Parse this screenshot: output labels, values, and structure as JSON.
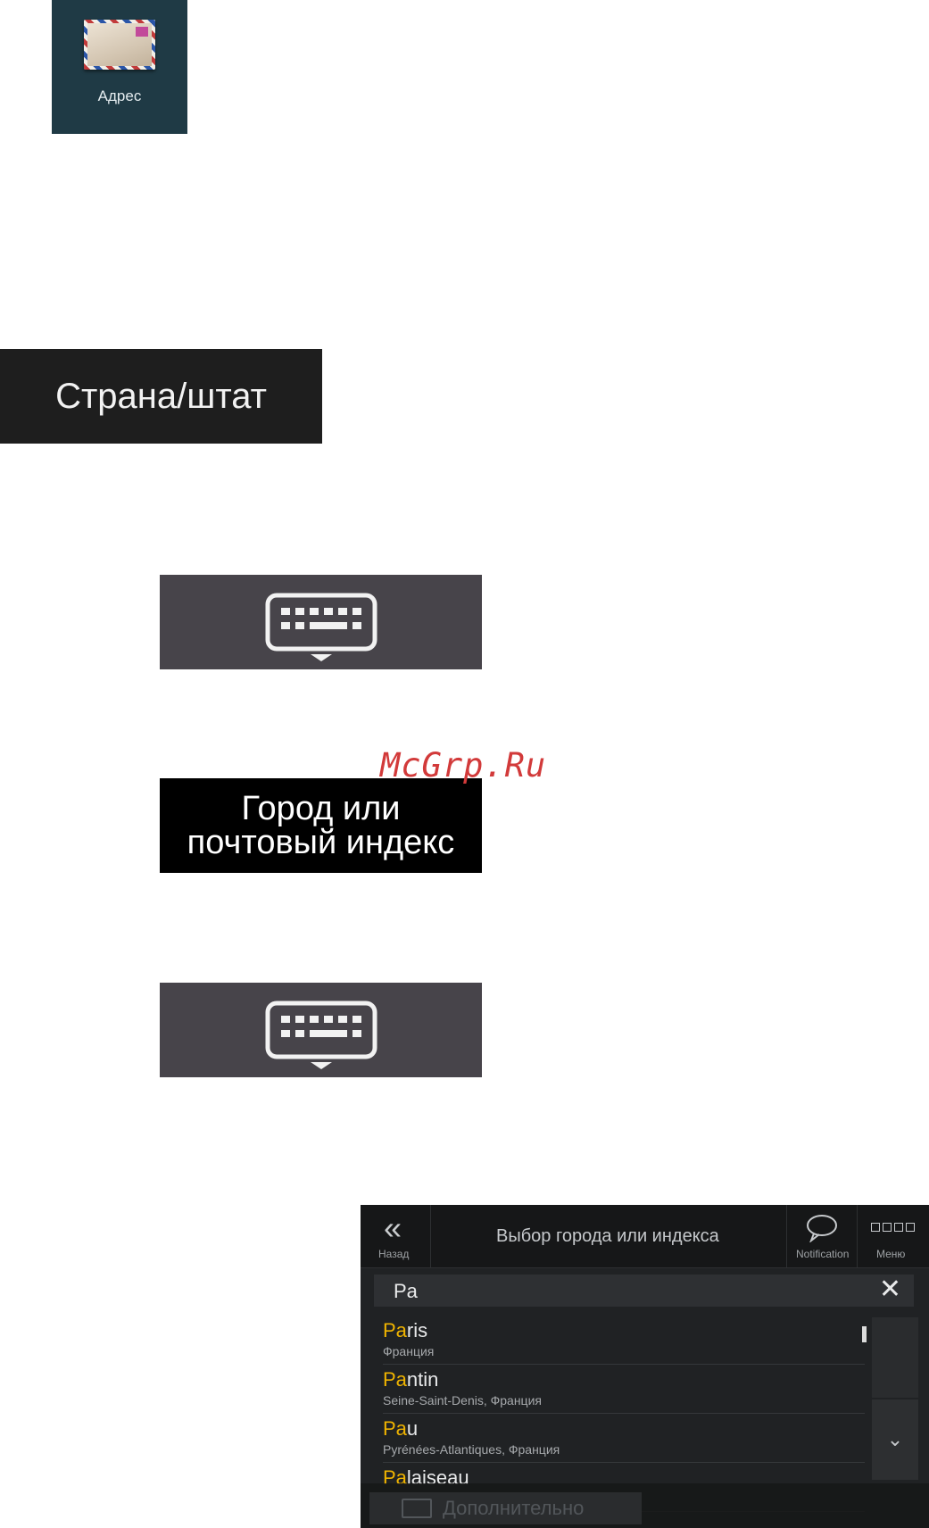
{
  "address_tile": {
    "label": "Адрес",
    "icon": "envelope-icon"
  },
  "country_button": {
    "label": "Страна/штат"
  },
  "keyboard_button": {
    "icon": "keyboard-icon"
  },
  "city_button": {
    "line1": "Город или",
    "line2": "почтовый индекс"
  },
  "watermark": {
    "text": "McGrp.Ru"
  },
  "nav_screen": {
    "header": {
      "back_label": "Назад",
      "back_icon": "double-chevron-left-icon",
      "title": "Выбор города или индекса",
      "notification_label": "Notification",
      "notification_icon": "speech-bubble-icon",
      "menu_label": "Меню",
      "menu_icon": "grid-boxes-icon"
    },
    "search": {
      "value": "Pa",
      "clear_icon": "close-icon"
    },
    "results": [
      {
        "match": "Pa",
        "rest": "ris",
        "region": "Франция"
      },
      {
        "match": "Pa",
        "rest": "ntin",
        "region": "Seine-Saint-Denis, Франция"
      },
      {
        "match": "Pa",
        "rest": "u",
        "region": "Pyrénées-Atlantiques, Франция"
      },
      {
        "match": "Pa",
        "rest": "laiseau",
        "region": ""
      }
    ],
    "more_button": {
      "label": "Дополнительно"
    },
    "colors": {
      "highlight": "#f0b400",
      "background": "#202224"
    }
  }
}
